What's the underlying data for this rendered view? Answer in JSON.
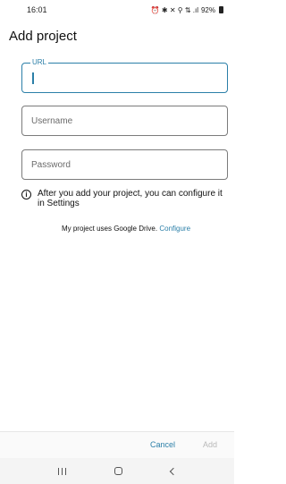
{
  "status_bar": {
    "time": "16:01",
    "icons_text": "⏰ ✱ ✕ ⚲ ⇅ .ıl",
    "battery": "92%"
  },
  "header": {
    "title": "Add project"
  },
  "form": {
    "url": {
      "label": "URL",
      "value": "",
      "placeholder": ""
    },
    "username": {
      "placeholder": "Username",
      "value": ""
    },
    "password": {
      "placeholder": "Password",
      "value": ""
    }
  },
  "info": {
    "icon": "info-icon",
    "message": "After you add your project, you can configure it in Settings"
  },
  "drive": {
    "text": "My project uses Google Drive.",
    "link": "Configure"
  },
  "actions": {
    "cancel_label": "Cancel",
    "add_label": "Add"
  },
  "colors": {
    "accent": "#2b7fa8",
    "disabled": "#b9b9b9"
  }
}
